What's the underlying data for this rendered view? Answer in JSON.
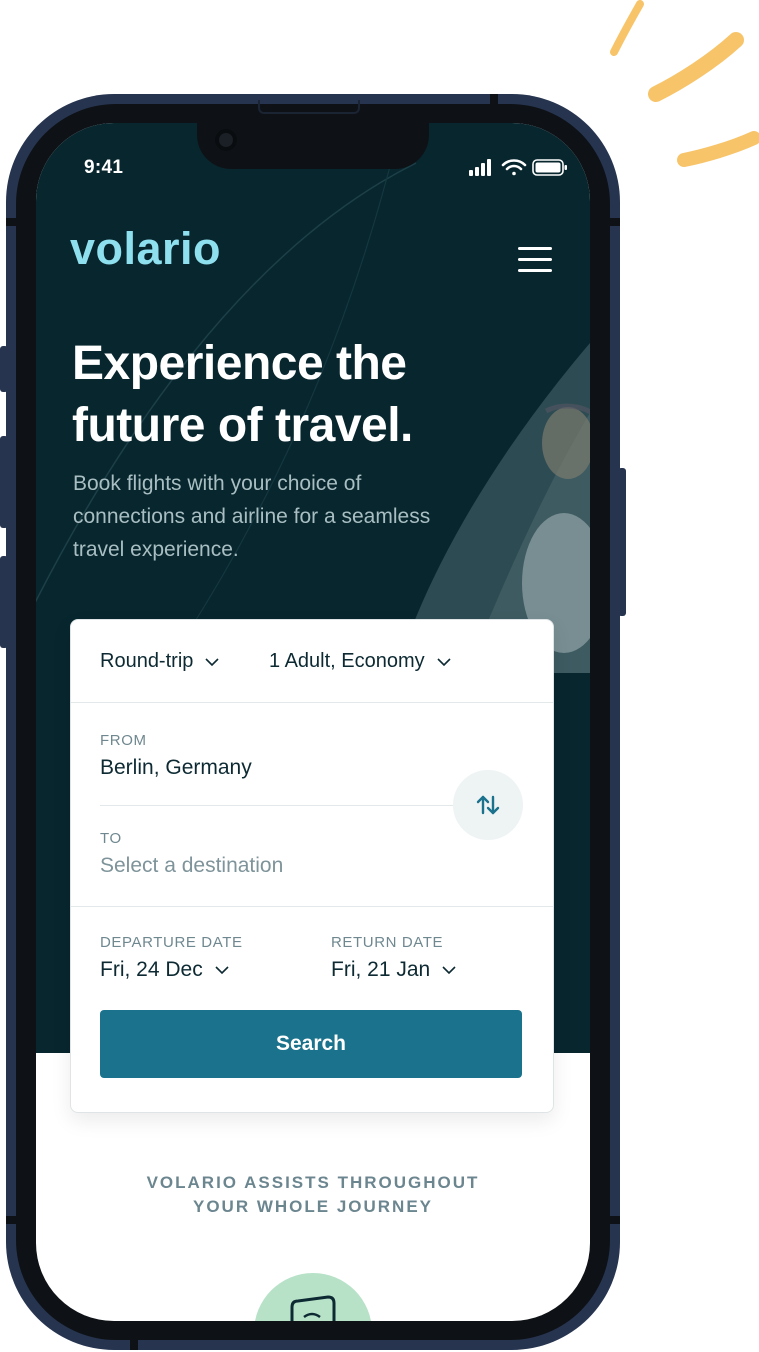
{
  "colors": {
    "hero_bg": "#08262e",
    "logo": "#8fe0ef",
    "accent_button": "#1a728c",
    "decor_strokes": "#f7c46a",
    "phone_frame": "#26344f",
    "feature_blob": "#b7e2c8"
  },
  "status_bar": {
    "time": "9:41",
    "icons": [
      "signal-icon",
      "wifi-icon",
      "battery-icon"
    ]
  },
  "header": {
    "logo": "volario",
    "menu_icon": "hamburger-menu-icon"
  },
  "hero": {
    "headline": "Experience the future of travel.",
    "subtext": "Book flights with your choice of connections and airline for a seamless travel experience."
  },
  "booking": {
    "trip_type": "Round-trip",
    "passengers": "1 Adult, Economy",
    "from_label": "FROM",
    "from_value": "Berlin, Germany",
    "to_label": "TO",
    "to_placeholder": "Select a destination",
    "swap_icon": "swap-arrows-icon",
    "departure_label": "DEPARTURE DATE",
    "departure_value": "Fri, 24 Dec",
    "return_label": "RETURN DATE",
    "return_value": "Fri, 21 Jan",
    "search_label": "Search"
  },
  "assist": {
    "line1": "VOLARIO ASSISTS THROUGHOUT",
    "line2": "YOUR WHOLE JOURNEY"
  }
}
